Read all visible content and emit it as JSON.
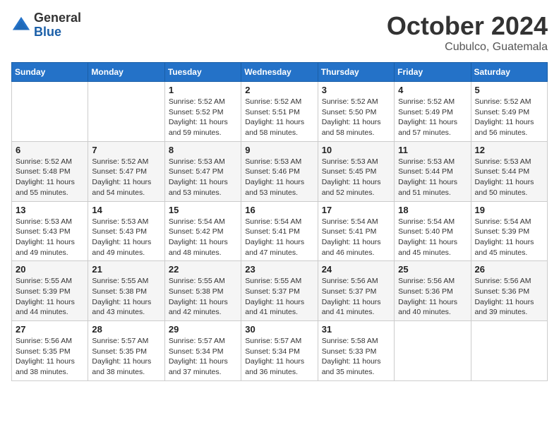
{
  "header": {
    "logo_general": "General",
    "logo_blue": "Blue",
    "month_title": "October 2024",
    "location": "Cubulco, Guatemala"
  },
  "weekdays": [
    "Sunday",
    "Monday",
    "Tuesday",
    "Wednesday",
    "Thursday",
    "Friday",
    "Saturday"
  ],
  "weeks": [
    [
      {
        "day": "",
        "sunrise": "",
        "sunset": "",
        "daylight": ""
      },
      {
        "day": "",
        "sunrise": "",
        "sunset": "",
        "daylight": ""
      },
      {
        "day": "1",
        "sunrise": "Sunrise: 5:52 AM",
        "sunset": "Sunset: 5:52 PM",
        "daylight": "Daylight: 11 hours and 59 minutes."
      },
      {
        "day": "2",
        "sunrise": "Sunrise: 5:52 AM",
        "sunset": "Sunset: 5:51 PM",
        "daylight": "Daylight: 11 hours and 58 minutes."
      },
      {
        "day": "3",
        "sunrise": "Sunrise: 5:52 AM",
        "sunset": "Sunset: 5:50 PM",
        "daylight": "Daylight: 11 hours and 58 minutes."
      },
      {
        "day": "4",
        "sunrise": "Sunrise: 5:52 AM",
        "sunset": "Sunset: 5:49 PM",
        "daylight": "Daylight: 11 hours and 57 minutes."
      },
      {
        "day": "5",
        "sunrise": "Sunrise: 5:52 AM",
        "sunset": "Sunset: 5:49 PM",
        "daylight": "Daylight: 11 hours and 56 minutes."
      }
    ],
    [
      {
        "day": "6",
        "sunrise": "Sunrise: 5:52 AM",
        "sunset": "Sunset: 5:48 PM",
        "daylight": "Daylight: 11 hours and 55 minutes."
      },
      {
        "day": "7",
        "sunrise": "Sunrise: 5:52 AM",
        "sunset": "Sunset: 5:47 PM",
        "daylight": "Daylight: 11 hours and 54 minutes."
      },
      {
        "day": "8",
        "sunrise": "Sunrise: 5:53 AM",
        "sunset": "Sunset: 5:47 PM",
        "daylight": "Daylight: 11 hours and 53 minutes."
      },
      {
        "day": "9",
        "sunrise": "Sunrise: 5:53 AM",
        "sunset": "Sunset: 5:46 PM",
        "daylight": "Daylight: 11 hours and 53 minutes."
      },
      {
        "day": "10",
        "sunrise": "Sunrise: 5:53 AM",
        "sunset": "Sunset: 5:45 PM",
        "daylight": "Daylight: 11 hours and 52 minutes."
      },
      {
        "day": "11",
        "sunrise": "Sunrise: 5:53 AM",
        "sunset": "Sunset: 5:44 PM",
        "daylight": "Daylight: 11 hours and 51 minutes."
      },
      {
        "day": "12",
        "sunrise": "Sunrise: 5:53 AM",
        "sunset": "Sunset: 5:44 PM",
        "daylight": "Daylight: 11 hours and 50 minutes."
      }
    ],
    [
      {
        "day": "13",
        "sunrise": "Sunrise: 5:53 AM",
        "sunset": "Sunset: 5:43 PM",
        "daylight": "Daylight: 11 hours and 49 minutes."
      },
      {
        "day": "14",
        "sunrise": "Sunrise: 5:53 AM",
        "sunset": "Sunset: 5:43 PM",
        "daylight": "Daylight: 11 hours and 49 minutes."
      },
      {
        "day": "15",
        "sunrise": "Sunrise: 5:54 AM",
        "sunset": "Sunset: 5:42 PM",
        "daylight": "Daylight: 11 hours and 48 minutes."
      },
      {
        "day": "16",
        "sunrise": "Sunrise: 5:54 AM",
        "sunset": "Sunset: 5:41 PM",
        "daylight": "Daylight: 11 hours and 47 minutes."
      },
      {
        "day": "17",
        "sunrise": "Sunrise: 5:54 AM",
        "sunset": "Sunset: 5:41 PM",
        "daylight": "Daylight: 11 hours and 46 minutes."
      },
      {
        "day": "18",
        "sunrise": "Sunrise: 5:54 AM",
        "sunset": "Sunset: 5:40 PM",
        "daylight": "Daylight: 11 hours and 45 minutes."
      },
      {
        "day": "19",
        "sunrise": "Sunrise: 5:54 AM",
        "sunset": "Sunset: 5:39 PM",
        "daylight": "Daylight: 11 hours and 45 minutes."
      }
    ],
    [
      {
        "day": "20",
        "sunrise": "Sunrise: 5:55 AM",
        "sunset": "Sunset: 5:39 PM",
        "daylight": "Daylight: 11 hours and 44 minutes."
      },
      {
        "day": "21",
        "sunrise": "Sunrise: 5:55 AM",
        "sunset": "Sunset: 5:38 PM",
        "daylight": "Daylight: 11 hours and 43 minutes."
      },
      {
        "day": "22",
        "sunrise": "Sunrise: 5:55 AM",
        "sunset": "Sunset: 5:38 PM",
        "daylight": "Daylight: 11 hours and 42 minutes."
      },
      {
        "day": "23",
        "sunrise": "Sunrise: 5:55 AM",
        "sunset": "Sunset: 5:37 PM",
        "daylight": "Daylight: 11 hours and 41 minutes."
      },
      {
        "day": "24",
        "sunrise": "Sunrise: 5:56 AM",
        "sunset": "Sunset: 5:37 PM",
        "daylight": "Daylight: 11 hours and 41 minutes."
      },
      {
        "day": "25",
        "sunrise": "Sunrise: 5:56 AM",
        "sunset": "Sunset: 5:36 PM",
        "daylight": "Daylight: 11 hours and 40 minutes."
      },
      {
        "day": "26",
        "sunrise": "Sunrise: 5:56 AM",
        "sunset": "Sunset: 5:36 PM",
        "daylight": "Daylight: 11 hours and 39 minutes."
      }
    ],
    [
      {
        "day": "27",
        "sunrise": "Sunrise: 5:56 AM",
        "sunset": "Sunset: 5:35 PM",
        "daylight": "Daylight: 11 hours and 38 minutes."
      },
      {
        "day": "28",
        "sunrise": "Sunrise: 5:57 AM",
        "sunset": "Sunset: 5:35 PM",
        "daylight": "Daylight: 11 hours and 38 minutes."
      },
      {
        "day": "29",
        "sunrise": "Sunrise: 5:57 AM",
        "sunset": "Sunset: 5:34 PM",
        "daylight": "Daylight: 11 hours and 37 minutes."
      },
      {
        "day": "30",
        "sunrise": "Sunrise: 5:57 AM",
        "sunset": "Sunset: 5:34 PM",
        "daylight": "Daylight: 11 hours and 36 minutes."
      },
      {
        "day": "31",
        "sunrise": "Sunrise: 5:58 AM",
        "sunset": "Sunset: 5:33 PM",
        "daylight": "Daylight: 11 hours and 35 minutes."
      },
      {
        "day": "",
        "sunrise": "",
        "sunset": "",
        "daylight": ""
      },
      {
        "day": "",
        "sunrise": "",
        "sunset": "",
        "daylight": ""
      }
    ]
  ]
}
